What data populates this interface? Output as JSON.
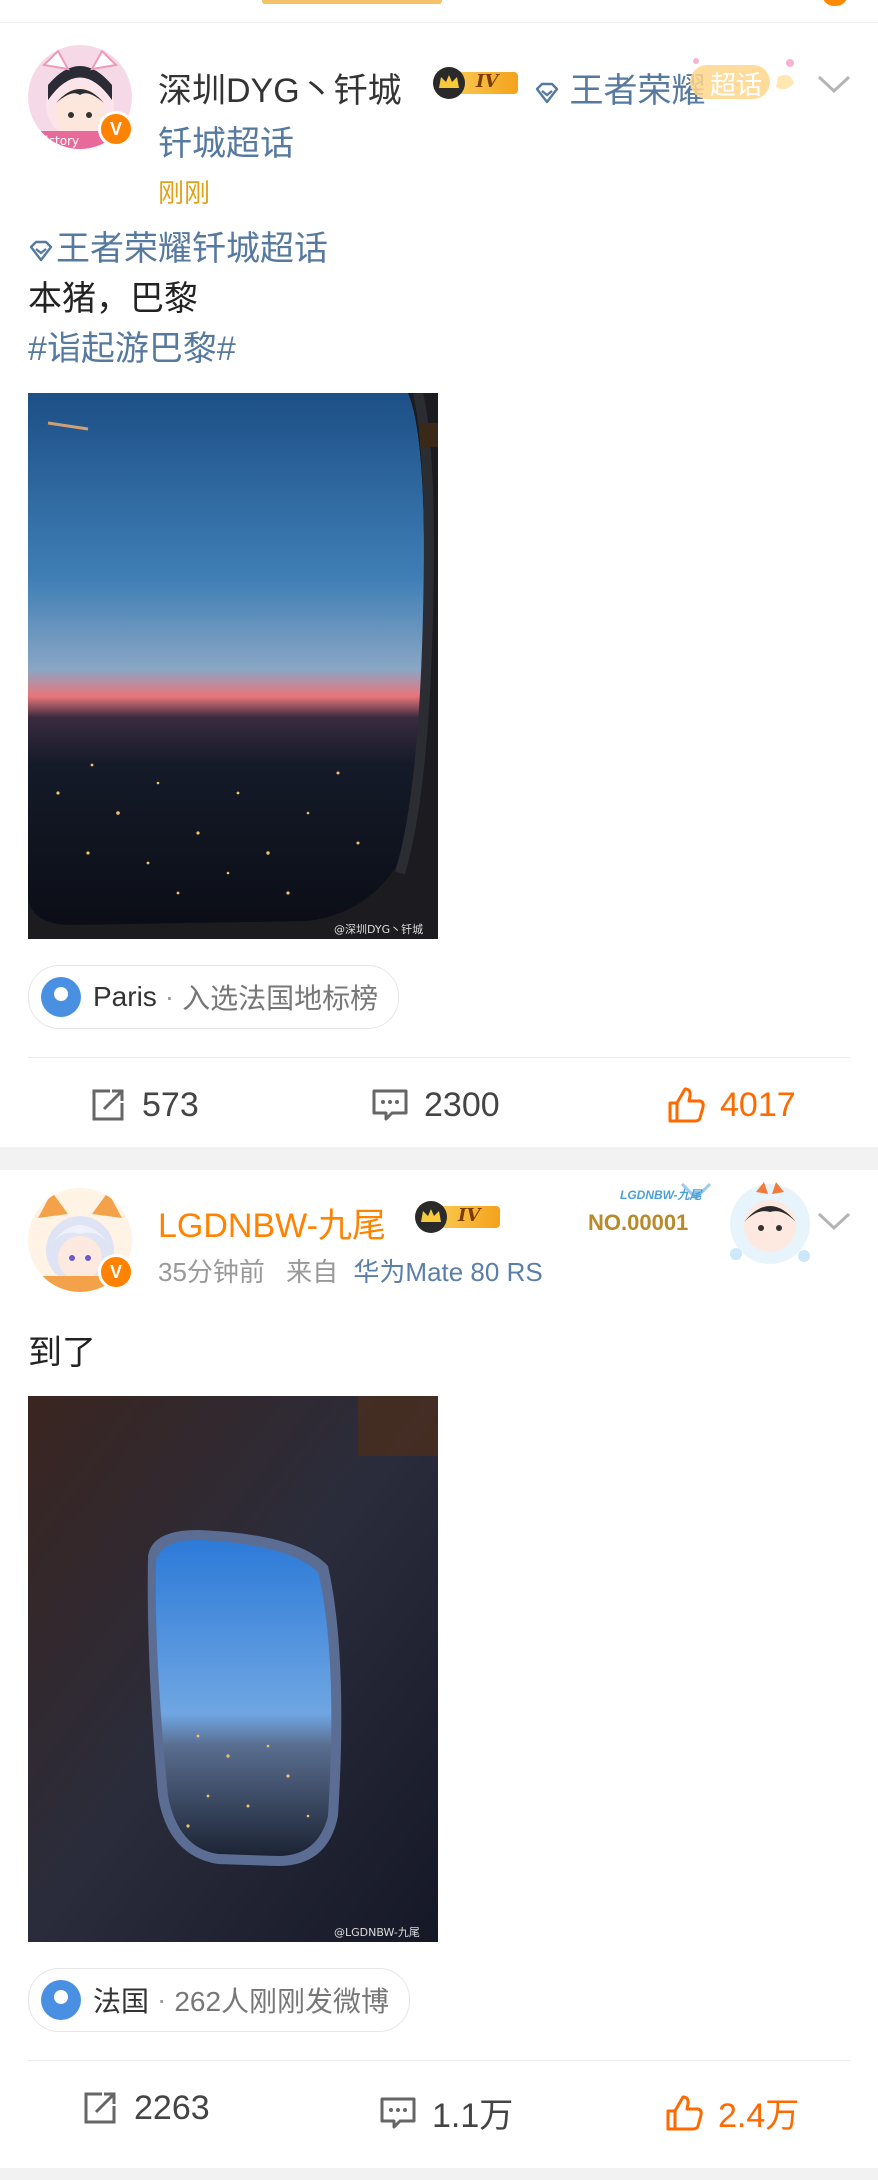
{
  "posts": [
    {
      "username": "深圳DYG丶钎城",
      "level": "IV",
      "topic_inline": "王者荣耀",
      "topic_inline_line2": "钎城超话",
      "sticker_text": "超话",
      "time": "刚刚",
      "topic_tag": "王者荣耀钎城超话",
      "text_line1": "本猪，巴黎",
      "hashtag": "#诣起游巴黎#",
      "watermark": "@深圳DYG丶钎城",
      "avatar_tag": "victory",
      "location": {
        "name": "Paris",
        "desc": "入选法国地标榜"
      },
      "actions": {
        "repost": "573",
        "comment": "2300",
        "like": "4017"
      }
    },
    {
      "username": "LGDNBW-九尾",
      "level": "IV",
      "time": "35分钟前",
      "source_prefix": "来自",
      "source": "华为Mate 80 RS",
      "badge_no": "NO.00001",
      "badge_name": "LGDNBW-九尾",
      "text_line1": "到了",
      "watermark": "@LGDNBW-九尾",
      "location": {
        "name": "法国",
        "desc": "262人刚刚发微博"
      },
      "actions": {
        "repost": "2263",
        "comment": "1.1万",
        "like": "2.4万"
      }
    }
  ],
  "colors": {
    "accent": "#ff8200",
    "link": "#56799f",
    "like": "#ff6a00"
  }
}
